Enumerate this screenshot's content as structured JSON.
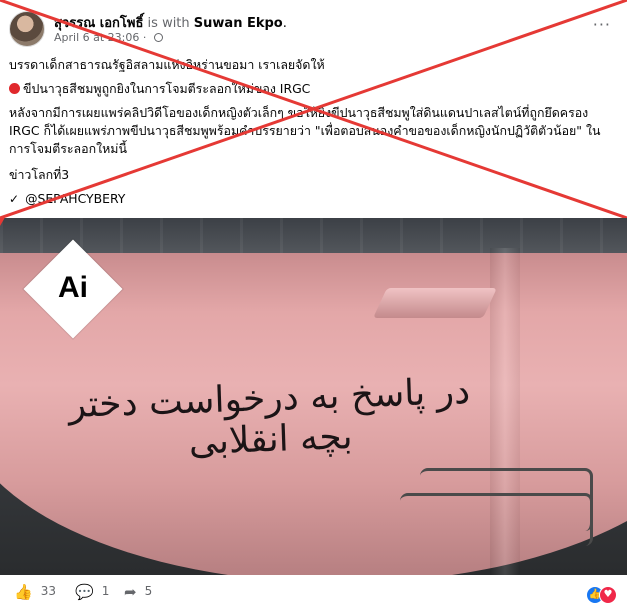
{
  "post": {
    "author": "สุวรรณ เอกโพธิ์",
    "with_text": "is with",
    "tagged": "Suwan Ekpo",
    "date": "April 6 at 23:06",
    "more_icon": "more-horizontal-icon",
    "privacy_icon": "globe-icon",
    "text_lines": [
      "บรรดาเด็กสาธารณรัฐอิสลามแห่งอิหร่านขอมา เราเลยจัดให้",
      "ขีปนาวุธสีชมพูถูกยิงในการโจมตีระลอกใหม่ของ IRGC",
      "หลังจากมีการเผยแพร่คลิปวิดีโอของเด็กหญิงตัวเล็กๆ ขอให้ยิงขีปนาวุธสีชมพูใส่ดินแดนปาเลสไตน์ที่ถูกยึดครอง  IRGC ก็ได้เผยแพร่ภาพขีปนาวุธสีชมพูพร้อมคำบรรยายว่า \"เพื่อตอบสนองคำขอของเด็กหญิงนักปฏิวัติตัวน้อย\" ในการโจมตีระลอกใหม่นี้",
      "ข่าวโลกที่3",
      "@SEPAHCYBERY"
    ],
    "red_dot_color": "#e0282c",
    "overlay_color": "#e53935"
  },
  "image": {
    "badge": "Ai",
    "missile_text": "در پاسخ به درخواست دختر بچه انقلابی"
  },
  "footer": {
    "likes": "33",
    "comments": "1",
    "shares": "5",
    "like_icon": "thumbs-up-icon",
    "comment_icon": "comment-icon",
    "share_icon": "share-icon"
  }
}
